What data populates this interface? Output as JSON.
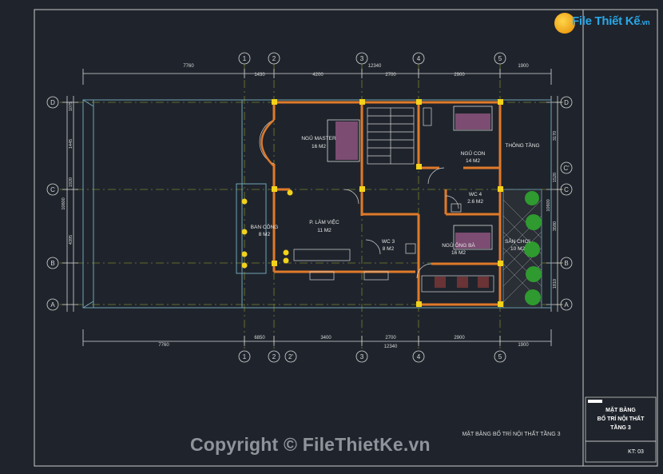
{
  "logo": {
    "brand": "File Thiết Kế",
    "tld": ".vn"
  },
  "watermark": "Copyright © FileThietKe.vn",
  "sheet_caption": "MẶT BẰNG BỐ TRÍ NỘI THẤT TẦNG 3",
  "title_block": {
    "line1": "MẶT BẰNG",
    "line2": "BỐ TRÍ NỘI THẤT",
    "line3": "TẦNG 3",
    "sheet_no": "KT: 03"
  },
  "top_dims": [
    "7760",
    "1430",
    "4200",
    "12340",
    "2700",
    "2900",
    "1900"
  ],
  "bottom_dims": [
    "7760",
    "6850",
    "3400",
    "2700",
    "12340",
    "2900",
    "1900"
  ],
  "left_dims": [
    "1075",
    "1445",
    "10600",
    "4395",
    "1920"
  ],
  "right_dims": [
    "3170",
    "1520",
    "10600",
    "3580",
    "1810"
  ],
  "grid_top": [
    "1",
    "2",
    "3",
    "4",
    "5"
  ],
  "grid_bottom": [
    "1",
    "2",
    "2'",
    "3",
    "4",
    "5"
  ],
  "grid_side": [
    "D",
    "C",
    "B",
    "A"
  ],
  "grid_right_extra": "C'",
  "rooms": [
    {
      "name": "NGỦ MASTER",
      "area": "16 M2"
    },
    {
      "name": "NGỦ CON",
      "area": "14 M2"
    },
    {
      "name": "THÔNG TẦNG",
      "area": ""
    },
    {
      "name": "P. LÀM VIỆC",
      "area": "11 M2"
    },
    {
      "name": "BAN CÔNG",
      "area": "8 M2"
    },
    {
      "name": "WC 4",
      "area": "2.6 M2"
    },
    {
      "name": "WC 3",
      "area": "8 M2"
    },
    {
      "name": "NGỦ ÔNG BÀ",
      "area": "16 M2"
    },
    {
      "name": "SÂN CHƠI",
      "area": "10 M2"
    }
  ],
  "colors": {
    "background": "#1f242c",
    "wall": "#e07a2a",
    "column": "#f2d21a",
    "grid": "#7a7d2c",
    "dimension": "#d6d6d6",
    "terrace": "#6fa3b5",
    "plant": "#2f9a2f"
  }
}
